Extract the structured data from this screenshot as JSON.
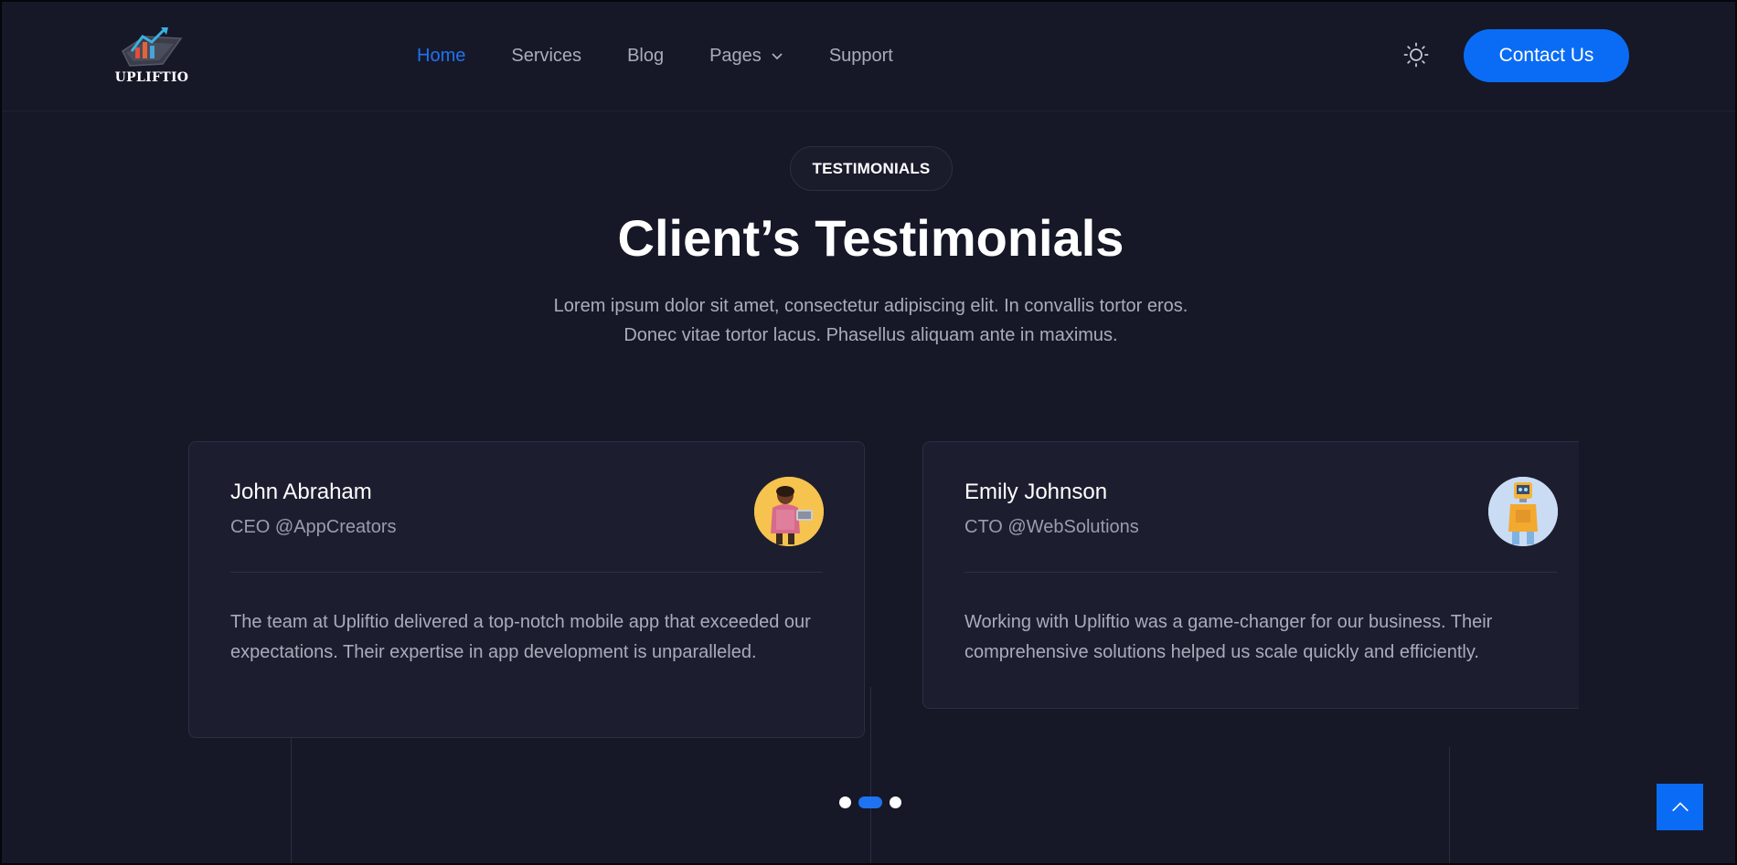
{
  "header": {
    "logo_text": "UPLIFTIO",
    "nav": [
      {
        "label": "Home",
        "active": true
      },
      {
        "label": "Services",
        "active": false
      },
      {
        "label": "Blog",
        "active": false
      },
      {
        "label": "Pages",
        "active": false,
        "has_dropdown": true
      },
      {
        "label": "Support",
        "active": false
      }
    ],
    "theme_toggle_icon": "sun-icon",
    "contact_label": "Contact Us"
  },
  "section": {
    "badge": "TESTIMONIALS",
    "title": "Client’s Testimonials",
    "subtitle_lines": [
      "Lorem ipsum dolor sit amet, consectetur adipiscing elit. In convallis tortor eros.",
      "Donec vitae tortor lacus. Phasellus aliquam ante in maximus."
    ]
  },
  "testimonials": [
    {
      "name": "John Abraham",
      "role": "CEO @AppCreators",
      "quote": "The team at Upliftio delivered a top-notch mobile app that exceeded our expectations. Their expertise in app development is unparalleled.",
      "avatar_icon": "person-with-laptop-avatar"
    },
    {
      "name": "Emily Johnson",
      "role": "CTO @WebSolutions",
      "quote": "Working with Upliftio was a game-changer for our business. Their comprehensive solutions helped us scale quickly and efficiently.",
      "avatar_icon": "robot-avatar"
    }
  ],
  "pagination": {
    "count": 3,
    "active_index": 1
  },
  "colors": {
    "background": "#161828",
    "card": "#1c1e30",
    "accent": "#0a6cf5",
    "active_link": "#1f73f1",
    "muted_text": "#a9acb9"
  },
  "back_to_top_icon": "chevron-up-icon"
}
